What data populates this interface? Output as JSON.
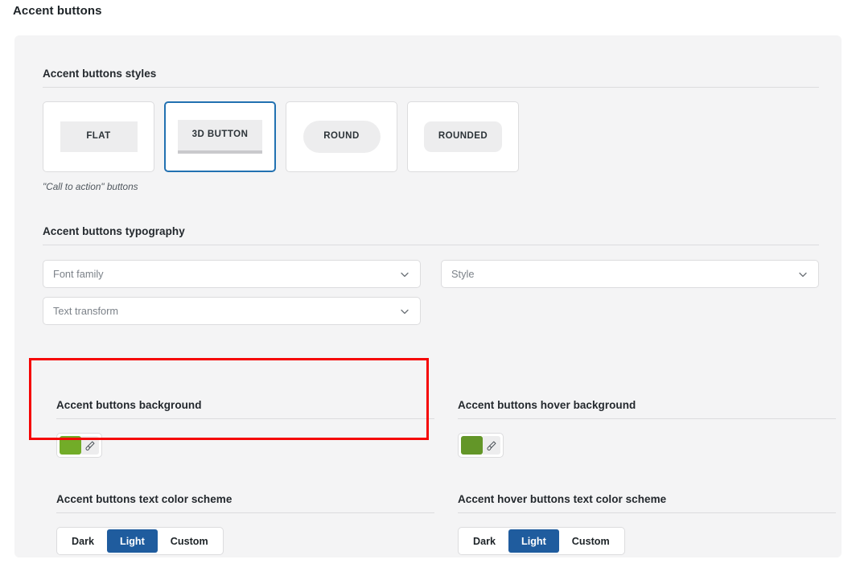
{
  "page": {
    "title": "Accent buttons"
  },
  "styles_section": {
    "heading": "Accent buttons styles",
    "caption": "\"Call to action\" buttons",
    "options": [
      {
        "label": "FLAT",
        "shape": "flat",
        "selected": false
      },
      {
        "label": "3D BUTTON",
        "shape": "threed",
        "selected": true
      },
      {
        "label": "ROUND",
        "shape": "round",
        "selected": false
      },
      {
        "label": "ROUNDED",
        "shape": "rounded",
        "selected": false
      }
    ]
  },
  "typography_section": {
    "heading": "Accent buttons typography",
    "fields": [
      {
        "placeholder": "Font family",
        "value": "",
        "icon": "chevron-down-icon"
      },
      {
        "placeholder": "Style",
        "value": "",
        "icon": "chevron-down-icon"
      },
      {
        "placeholder": "Text transform",
        "value": "",
        "icon": "chevron-down-icon"
      }
    ]
  },
  "background_section": {
    "heading": "Accent buttons background",
    "swatch_color": "#72ac28",
    "brush_icon": "paintbrush-icon"
  },
  "hover_background_section": {
    "heading": "Accent buttons hover background",
    "swatch_color": "#639628",
    "brush_icon": "paintbrush-icon"
  },
  "text_scheme_section": {
    "heading": "Accent buttons text color scheme",
    "options": [
      {
        "label": "Dark",
        "selected": false
      },
      {
        "label": "Light",
        "selected": true
      },
      {
        "label": "Custom",
        "selected": false
      }
    ]
  },
  "hover_text_scheme_section": {
    "heading": "Accent hover buttons text color scheme",
    "options": [
      {
        "label": "Dark",
        "selected": false
      },
      {
        "label": "Light",
        "selected": true
      },
      {
        "label": "Custom",
        "selected": false
      }
    ]
  },
  "annotation": {
    "type": "highlight-rectangle",
    "color": "#f50505",
    "targets": "background_section"
  },
  "colors": {
    "accent_blue": "#1f5c9e",
    "selected_border": "#2271b1",
    "panel_bg": "#f4f4f5",
    "card_bg": "#ffffff",
    "border": "#dcdcde",
    "text": "#1d2327"
  }
}
